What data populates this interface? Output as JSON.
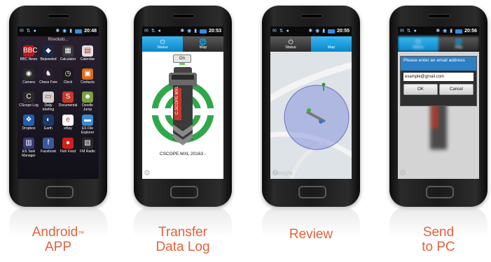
{
  "phones": [
    {
      "statusbar": {
        "time": "20:48"
      },
      "apps_header": "Rnvotuto...",
      "apps": [
        {
          "label": "BBC News",
          "icon": "bbc-news-icon",
          "color": "#bb1919",
          "glyph": "BBC"
        },
        {
          "label": "Bejeweled",
          "icon": "gem-icon",
          "color": "#1a2a4a",
          "glyph": "◆"
        },
        {
          "label": "Calculator",
          "icon": "calculator-icon",
          "color": "#3a3a3a",
          "glyph": "▦"
        },
        {
          "label": "Calendar",
          "icon": "calendar-icon",
          "color": "#e0e0e0",
          "glyph": "▤"
        },
        {
          "label": "Camera",
          "icon": "camera-icon",
          "color": "#2a2a2a",
          "glyph": "◉"
        },
        {
          "label": "Chess Free",
          "icon": "chess-icon",
          "color": "#2a2030",
          "glyph": "♞"
        },
        {
          "label": "Clock",
          "icon": "clock-icon",
          "color": "#1a1a1a",
          "glyph": "◷"
        },
        {
          "label": "Contacts",
          "icon": "contacts-icon",
          "color": "#e06a1a",
          "glyph": "▣"
        },
        {
          "label": "CScope Log",
          "icon": "cscope-icon",
          "color": "#2a2a2a",
          "glyph": "C"
        },
        {
          "label": "Daily briefing",
          "icon": "daily-briefing-icon",
          "color": "#d0d0d0",
          "glyph": "▭"
        },
        {
          "label": "Documental",
          "icon": "documental-icon",
          "color": "#c23a2a",
          "glyph": "S"
        },
        {
          "label": "Doodle Jump",
          "icon": "doodle-jump-icon",
          "color": "#7aa040",
          "glyph": "☻"
        },
        {
          "label": "Dropbox",
          "icon": "dropbox-icon",
          "color": "#1e5fb5",
          "glyph": "❖"
        },
        {
          "label": "Earth",
          "icon": "earth-icon",
          "color": "#1a3a6a",
          "glyph": "◐"
        },
        {
          "label": "eBay",
          "icon": "ebay-icon",
          "color": "#ffffff",
          "glyph": "e"
        },
        {
          "label": "ES File Explorer",
          "icon": "folder-icon",
          "color": "#3a8ad0",
          "glyph": "▬"
        },
        {
          "label": "ES Task Manager",
          "icon": "task-manager-icon",
          "color": "#3a3a7a",
          "glyph": "▥"
        },
        {
          "label": "Facebook",
          "icon": "facebook-icon",
          "color": "#3b5998",
          "glyph": "f"
        },
        {
          "label": "Fish Food",
          "icon": "fish-food-icon",
          "color": "#d02020",
          "glyph": "●"
        },
        {
          "label": "FM Radio",
          "icon": "radio-icon",
          "color": "#2a2a2a",
          "glyph": "▧"
        }
      ]
    },
    {
      "statusbar": {
        "time": "20:53"
      },
      "tabs": [
        {
          "label": "Status",
          "icon": "power-icon",
          "glyph": "⏻"
        },
        {
          "label": "Map",
          "icon": "globe-icon",
          "glyph": "🌐"
        }
      ],
      "on_button": "On",
      "device_label": "CSCOPE.MXL 20163 -",
      "device_name": "C.SCOPE MXL"
    },
    {
      "statusbar": {
        "time": "20:55"
      },
      "tabs": [
        {
          "label": "Status",
          "icon": "power-icon",
          "glyph": "⏻"
        },
        {
          "label": "Map",
          "icon": "globe-icon",
          "glyph": "🌐"
        }
      ],
      "map_watermark": "Google"
    },
    {
      "statusbar": {
        "time": "20:56"
      },
      "tabs": [
        {
          "label": "Status",
          "icon": "power-icon",
          "glyph": "⏻"
        },
        {
          "label": "Map",
          "icon": "globe-icon",
          "glyph": "🌐"
        }
      ],
      "dialog": {
        "title": "Please enter an email address",
        "input_value": "example@gmail.com",
        "ok": "OK",
        "cancel": "Cancel"
      }
    }
  ],
  "captions": [
    {
      "lines": [
        "Android",
        "APP"
      ],
      "tm": "™"
    },
    {
      "lines": [
        "Transfer",
        "Data Log"
      ]
    },
    {
      "lines": [
        "Review"
      ]
    },
    {
      "lines": [
        "Send",
        "to PC"
      ]
    }
  ],
  "colors": {
    "caption": "#e8613a",
    "tab_active": "#1aa0e0",
    "target_green": "#2fa84a",
    "dialog_blue": "#2b80c6"
  }
}
